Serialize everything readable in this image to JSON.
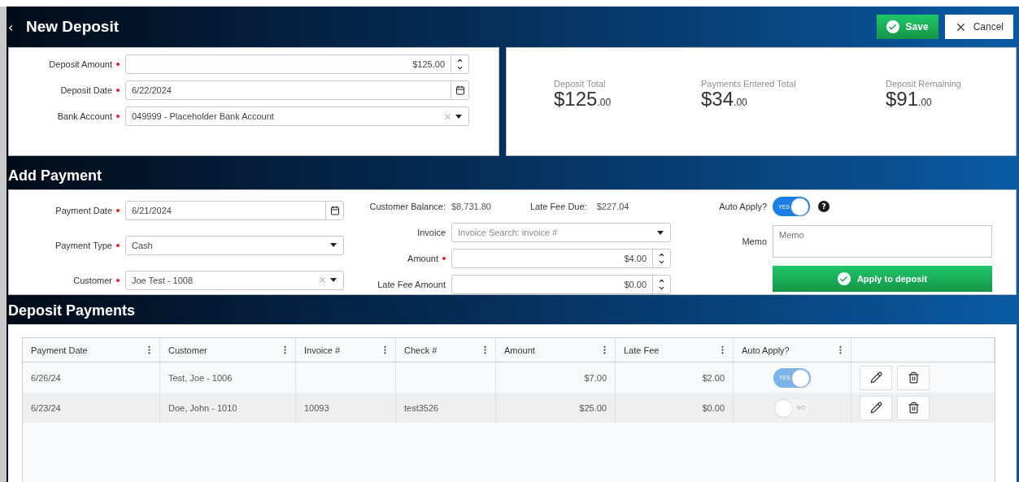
{
  "header": {
    "back": "‹",
    "title": "New Deposit",
    "buttons": [
      {
        "kind": "save",
        "label": "Save"
      },
      {
        "kind": "cancel",
        "label": "Cancel"
      }
    ]
  },
  "deposit": {
    "fields": [
      {
        "kind": "number",
        "label": "Deposit Amount",
        "required": true,
        "value": "$125.00"
      },
      {
        "kind": "date",
        "label": "Deposit Date",
        "required": true,
        "value": "6/22/2024"
      },
      {
        "kind": "select",
        "label": "Bank Account",
        "required": true,
        "value": "049999 - Placeholder Bank Account",
        "clearable": true
      }
    ]
  },
  "totals": [
    {
      "label": "Deposit Total",
      "whole": "$125",
      "cents": ".00"
    },
    {
      "label": "Payments Entered Total",
      "whole": "$34",
      "cents": ".00"
    },
    {
      "label": "Deposit Remaining",
      "whole": "$91",
      "cents": ".00"
    }
  ],
  "add_payment": {
    "title": "Add Payment",
    "left_fields": [
      {
        "kind": "date",
        "label": "Payment Date",
        "required": true,
        "value": "6/21/2024"
      },
      {
        "kind": "select",
        "label": "Payment Type",
        "required": true,
        "value": "Cash",
        "clearable": false
      },
      {
        "kind": "select",
        "label": "Customer",
        "required": true,
        "value": "Joe Test - 1008",
        "clearable": true
      }
    ],
    "info": [
      {
        "label": "Customer Balance:",
        "value": "$8,731.80"
      },
      {
        "label": "Late Fee Due:",
        "value": "$227.04"
      }
    ],
    "mid_fields": [
      {
        "kind": "select",
        "label": "Invoice",
        "required": false,
        "placeholder": "Invoice Search: invoice #",
        "clearable": false
      },
      {
        "kind": "number",
        "label": "Amount",
        "required": true,
        "value": "$4.00"
      },
      {
        "kind": "number",
        "label": "Late Fee Amount",
        "required": false,
        "value": "$0.00"
      }
    ],
    "auto_apply": {
      "label": "Auto Apply?",
      "on": true,
      "text": "YES",
      "help": "?"
    },
    "memo": {
      "label": "Memo",
      "placeholder": "Memo"
    },
    "apply_button": "Apply to deposit"
  },
  "payments": {
    "title": "Deposit Payments",
    "columns": [
      "Payment Date",
      "Customer",
      "Invoice #",
      "Check #",
      "Amount",
      "Late Fee",
      "Auto Apply?"
    ],
    "rows": [
      {
        "payment_date": "6/26/24",
        "customer": "Test, Joe - 1006",
        "invoice": "",
        "check": "",
        "amount": "$7.00",
        "late_fee": "$2.00",
        "auto_apply": {
          "on": true,
          "text": "YES"
        }
      },
      {
        "payment_date": "6/23/24",
        "customer": "Doe, John - 1010",
        "invoice": "10093",
        "check": "test3526",
        "amount": "$25.00",
        "late_fee": "$0.00",
        "auto_apply": {
          "on": false,
          "text": "NO"
        }
      }
    ]
  }
}
